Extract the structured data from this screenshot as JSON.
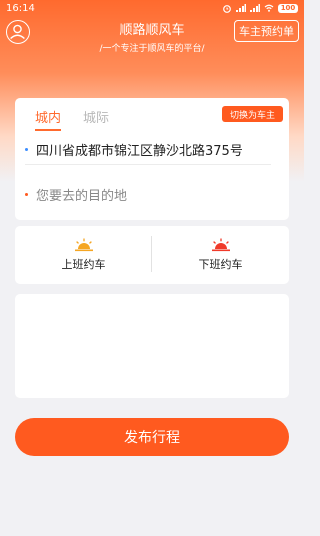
{
  "status_bar": {
    "time": "16:14",
    "battery": "100",
    "icons": [
      "alarm-icon",
      "signal-icon",
      "signal-icon",
      "wifi-icon",
      "battery-icon"
    ]
  },
  "header": {
    "title": "顺路顺风车",
    "subtitle": "/一个专注于顺风车的平台/",
    "driver_booking_label": "车主预约单",
    "avatar_icon": "user-avatar-icon"
  },
  "route_card": {
    "tabs": [
      {
        "label": "城内",
        "active": true
      },
      {
        "label": "城际",
        "active": false
      }
    ],
    "switch_label": "切换为车主",
    "from_address": "四川省成都市锦江区静沙北路375号",
    "to_placeholder": "您要去的目的地",
    "from_dot_color": "#3b8dff",
    "to_dot_color": "#ff5a1f"
  },
  "commute": {
    "to_work": {
      "label": "上班约车",
      "icon": "sunrise-icon",
      "color": "#f5a623"
    },
    "off_work": {
      "label": "下班约车",
      "icon": "sunset-icon",
      "color": "#f03a2a"
    }
  },
  "publish_label": "发布行程",
  "colors": {
    "accent": "#ff5a1f",
    "background": "#f1f1f4"
  }
}
